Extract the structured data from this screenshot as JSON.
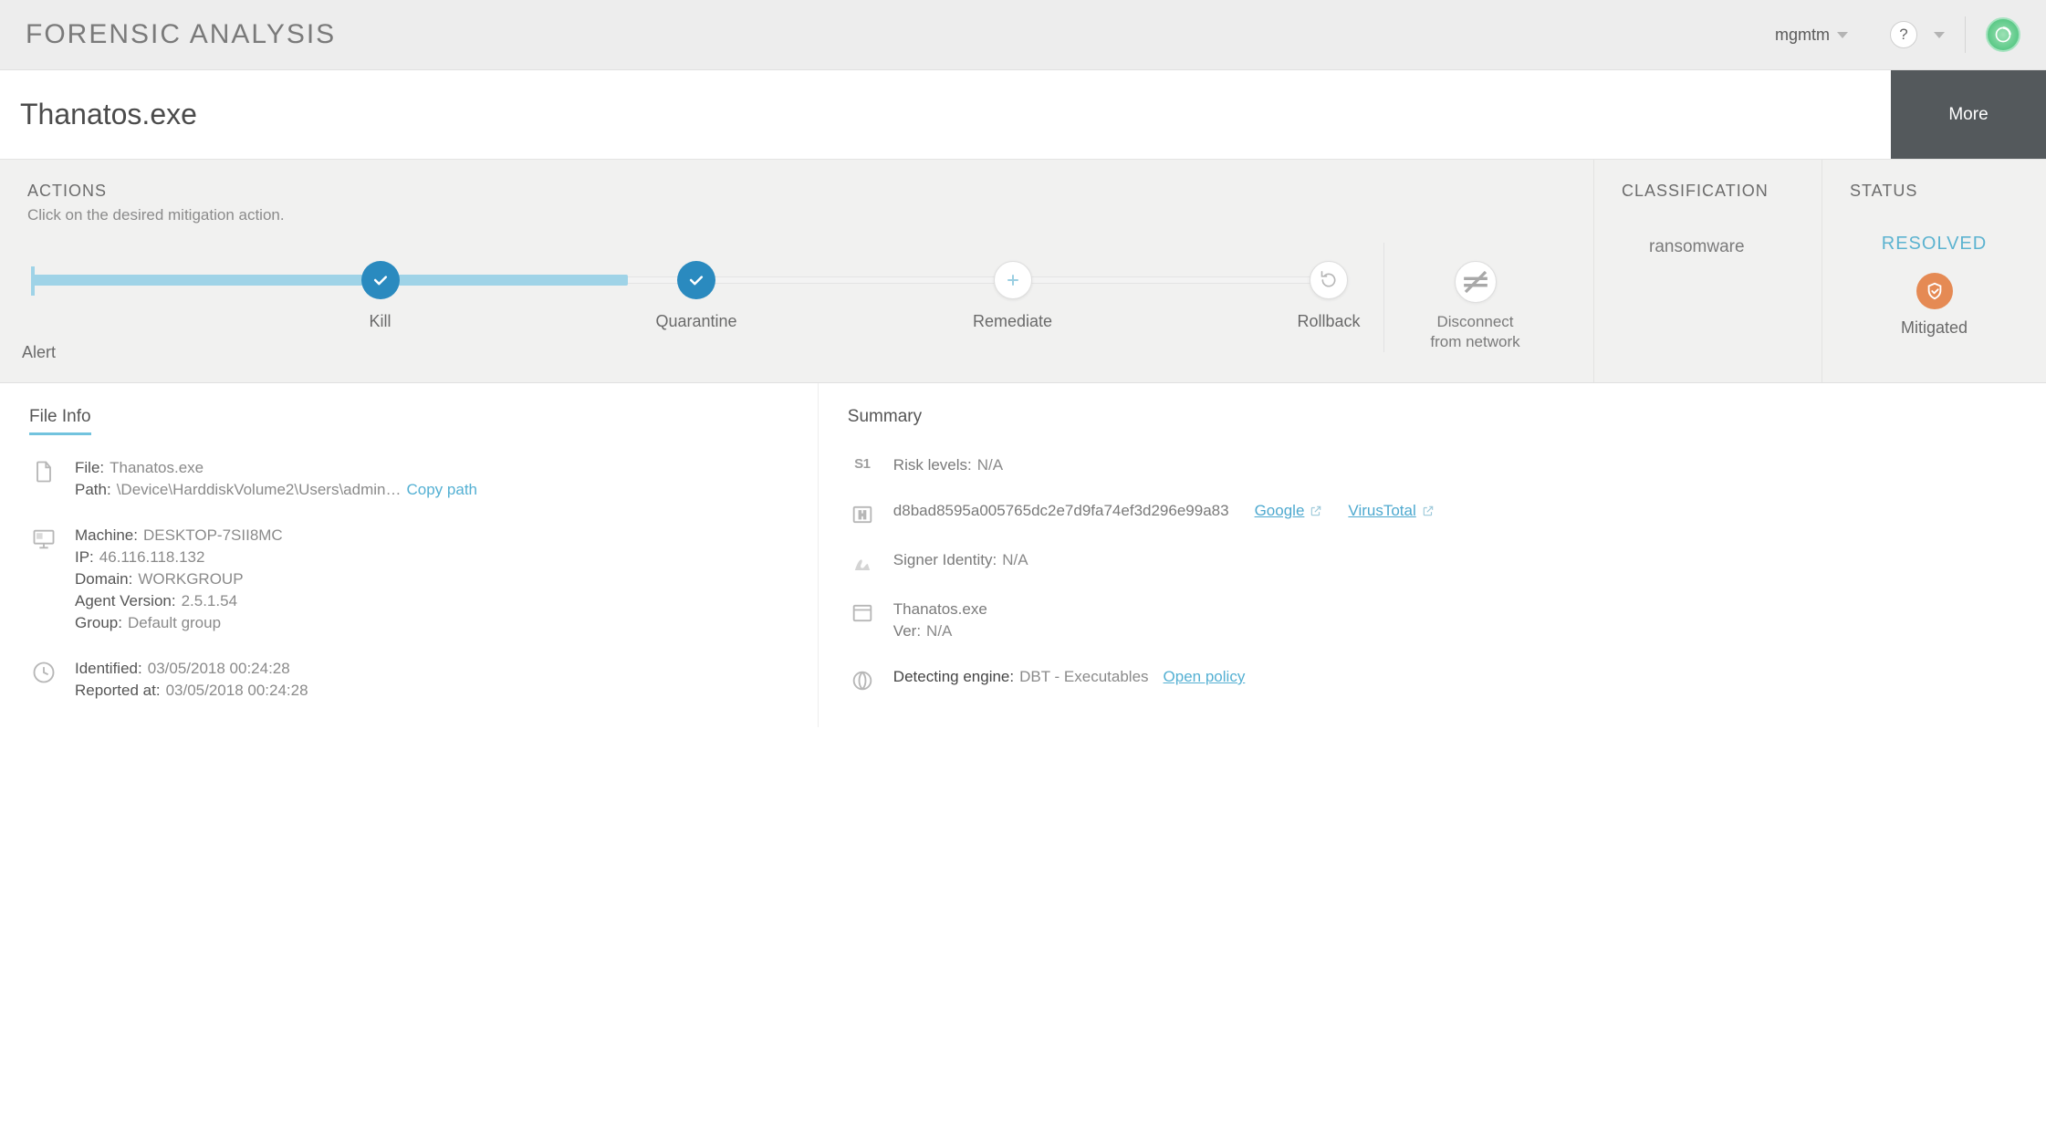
{
  "header": {
    "title": "FORENSIC ANALYSIS",
    "user": "mgmtm",
    "help": "?"
  },
  "threat": {
    "name": "Thanatos.exe",
    "more_label": "More"
  },
  "actions": {
    "heading": "ACTIONS",
    "subtext": "Click on the desired mitigation action.",
    "steps": {
      "alert": "Alert",
      "kill": "Kill",
      "quarantine": "Quarantine",
      "remediate": "Remediate",
      "rollback": "Rollback"
    },
    "disconnect_line1": "Disconnect",
    "disconnect_line2": "from network"
  },
  "classification": {
    "heading": "CLASSIFICATION",
    "value": "ransomware"
  },
  "status": {
    "heading": "STATUS",
    "resolved": "RESOLVED",
    "label": "Mitigated"
  },
  "fileinfo": {
    "tab": "File Info",
    "file_lbl": "File:",
    "file_val": "Thanatos.exe",
    "path_lbl": "Path:",
    "path_val": "\\Device\\HarddiskVolume2\\Users\\admin…",
    "copy_path": "Copy path",
    "machine_lbl": "Machine:",
    "machine_val": "DESKTOP-7SII8MC",
    "ip_lbl": "IP:",
    "ip_val": "46.116.118.132",
    "domain_lbl": "Domain:",
    "domain_val": "WORKGROUP",
    "agent_lbl": "Agent Version:",
    "agent_val": "2.5.1.54",
    "group_lbl": "Group:",
    "group_val": "Default group",
    "identified_lbl": "Identified:",
    "identified_val": "03/05/2018 00:24:28",
    "reported_lbl": "Reported at:",
    "reported_val": "03/05/2018 00:24:28"
  },
  "summary": {
    "heading": "Summary",
    "s1_tag": "S1",
    "risk_lbl": "Risk levels:",
    "risk_val": "N/A",
    "hash": "d8bad8595a005765dc2e7d9fa74ef3d296e99a83",
    "google": "Google",
    "virustotal": "VirusTotal",
    "signer_lbl": "Signer Identity:",
    "signer_val": "N/A",
    "app_name": "Thanatos.exe",
    "ver_lbl": "Ver:",
    "ver_val": "N/A",
    "engine_lbl": "Detecting engine:",
    "engine_val": "DBT - Executables",
    "open_policy": "Open policy"
  }
}
